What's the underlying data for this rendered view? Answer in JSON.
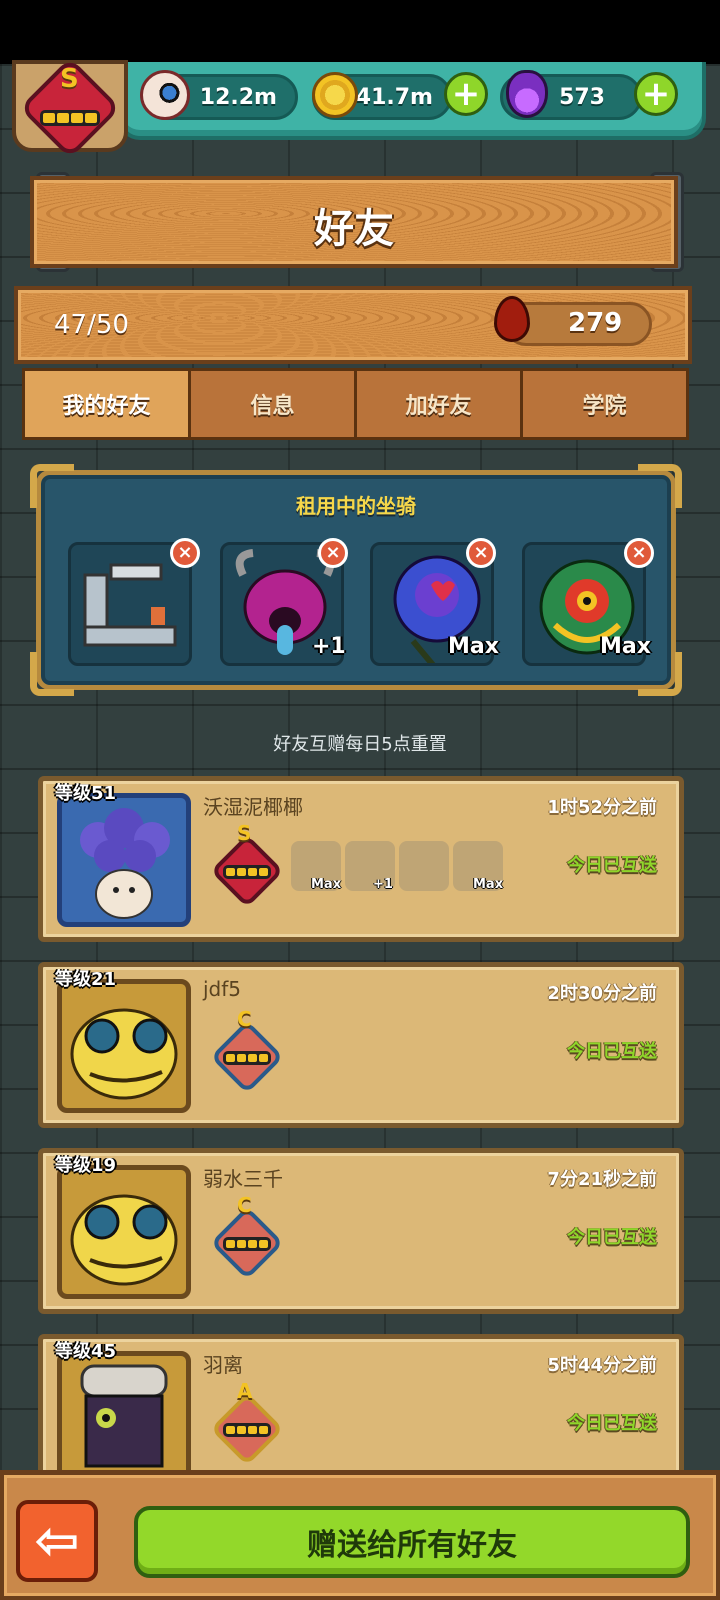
{
  "header": {
    "player_rank": "S",
    "resources": [
      {
        "name": "eyeball",
        "icon": "eyeball-icon",
        "value": "12.2m"
      },
      {
        "name": "coin",
        "icon": "coin-icon",
        "value": "41.7m"
      },
      {
        "name": "potion",
        "icon": "potion-icon",
        "value": "573"
      }
    ]
  },
  "title": "好友",
  "friend_count": "47/50",
  "blood_value": "279",
  "tabs": [
    {
      "label": "我的好友",
      "active": true
    },
    {
      "label": "信息",
      "active": false
    },
    {
      "label": "加好友",
      "active": false
    },
    {
      "label": "学院",
      "active": false
    }
  ],
  "mounts": {
    "title": "租用中的坐骑",
    "slots": [
      {
        "name": "machine-mount",
        "tag": ""
      },
      {
        "name": "horned-monster-mount",
        "tag": "+1"
      },
      {
        "name": "rose-mount",
        "tag": "Max"
      },
      {
        "name": "lion-dancer-mount",
        "tag": "Max"
      }
    ]
  },
  "reset_note": "好友互赠每日5点重置",
  "friends": [
    {
      "level": "等级51",
      "name": "沃湿泥椰椰",
      "time": "1时52分之前",
      "status": "今日已互送",
      "rank": "S",
      "mounts": [
        {
          "tag": "Max"
        },
        {
          "tag": "+1"
        },
        {
          "tag": ""
        },
        {
          "tag": "Max"
        }
      ]
    },
    {
      "level": "等级21",
      "name": "jdf5",
      "time": "2时30分之前",
      "status": "今日已互送",
      "rank": "C",
      "mounts": []
    },
    {
      "level": "等级19",
      "name": "弱水三千",
      "time": "7分21秒之前",
      "status": "今日已互送",
      "rank": "C",
      "mounts": []
    },
    {
      "level": "等级45",
      "name": "羽离",
      "time": "5时44分之前",
      "status": "今日已互送",
      "rank": "A",
      "mounts": []
    }
  ],
  "bottom": {
    "back_label": "⇦",
    "gift_all_label": "赠送给所有好友"
  }
}
